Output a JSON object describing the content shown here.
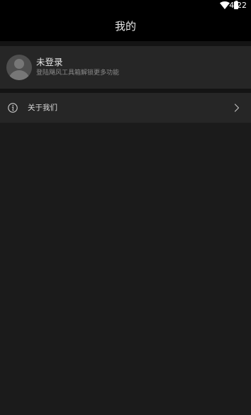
{
  "status_bar": {
    "time": "4:22",
    "icons": [
      "wifi-icon",
      "battery-icon"
    ]
  },
  "app_bar": {
    "title": "我的"
  },
  "profile": {
    "avatar_icon": "default-avatar-icon",
    "name": "未登录",
    "subtitle": "登陆飓风工具箱解锁更多功能"
  },
  "menu": {
    "items": [
      {
        "icon": "info-icon",
        "label": "关于我们",
        "trailing_icon": "chevron-right-icon"
      }
    ]
  },
  "colors": {
    "background": "#1b1b1b",
    "card": "#262626",
    "separator": "#141414",
    "app_bar": "#000000",
    "primary_text": "#e6e6e6",
    "secondary_text": "#8a8a8a"
  }
}
